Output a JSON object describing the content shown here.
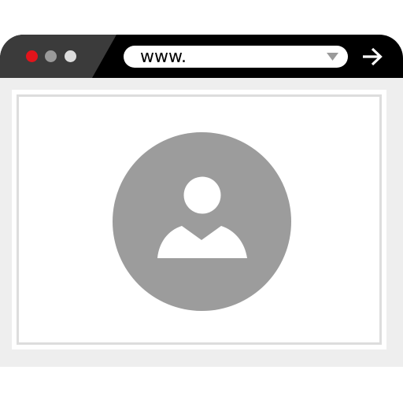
{
  "address_bar": {
    "url_text": "www."
  },
  "window_controls": {
    "close_color": "#e3141b",
    "minimize_color": "#9a9a9a",
    "maximize_color": "#dddddd"
  },
  "icons": {
    "dropdown": "chevron-down-icon",
    "go": "arrow-right-icon",
    "avatar": "user-icon"
  },
  "colors": {
    "title_bar": "#000000",
    "title_bar_accent": "#3b3b3b",
    "content_background": "#eeeeee",
    "avatar_circle": "#9c9c9c",
    "avatar_figure": "#ffffff"
  }
}
